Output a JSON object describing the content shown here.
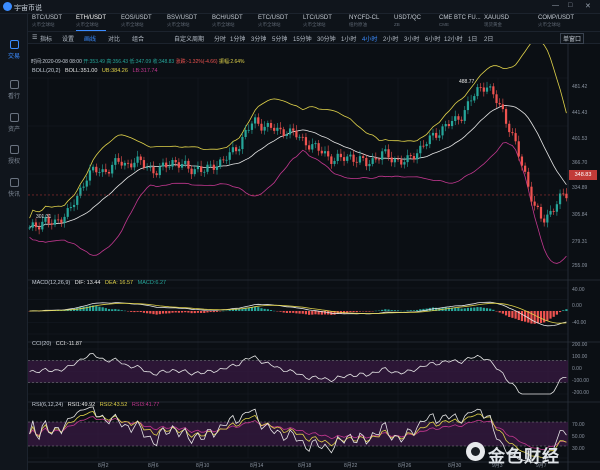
{
  "app": {
    "title": "宇宙币说"
  },
  "window": {
    "minimize": "—",
    "maximize": "□",
    "close": "✕"
  },
  "sidebar": {
    "items": [
      {
        "label": "交易",
        "icon": "chart-icon",
        "active": true
      },
      {
        "label": "看行",
        "icon": "quote-icon",
        "active": false
      },
      {
        "label": "资产",
        "icon": "wallet-icon",
        "active": false
      },
      {
        "label": "授权",
        "icon": "key-icon",
        "active": false
      },
      {
        "label": "快讯",
        "icon": "news-icon",
        "active": false
      }
    ]
  },
  "tickers": [
    {
      "symbol": "BTC/USDT",
      "sub": "火币全球站"
    },
    {
      "symbol": "ETH/USDT",
      "sub": "火币全球站",
      "active": true
    },
    {
      "symbol": "EOS/USDT",
      "sub": "火币全球站"
    },
    {
      "symbol": "BSV/USDT",
      "sub": "火币全球站"
    },
    {
      "symbol": "BCH/USDT",
      "sub": "火币全球站"
    },
    {
      "symbol": "ETC/USDT",
      "sub": "火币全球站"
    },
    {
      "symbol": "LTC/USDT",
      "sub": "火币全球站"
    },
    {
      "symbol": "NYCFD-CL",
      "sub": "纽约原油"
    },
    {
      "symbol": "USDT/QC",
      "sub": "ZB"
    },
    {
      "symbol": "CME BTC FU...",
      "sub": "CME"
    },
    {
      "symbol": "XAUUSD",
      "sub": "现货黄金"
    },
    {
      "symbol": "COMP/USDT",
      "sub": "火币全球站"
    }
  ],
  "toolbar": {
    "tools": [
      "指标",
      "设置",
      "画线",
      "对比",
      "组合"
    ],
    "active_tool": "画线",
    "custom_period": "自定义周期",
    "timeframes": [
      "分时",
      "1分钟",
      "3分钟",
      "5分钟",
      "15分钟",
      "30分钟",
      "1小时",
      "4小时",
      "2小时",
      "3小时",
      "6小时",
      "12小时",
      "1日",
      "2日"
    ],
    "active_timeframe": "4小时",
    "window_mode": "单窗口"
  },
  "info_line": {
    "time": "时间:2020-09-08 08:00",
    "open": "开:353.49",
    "high": "高:356.43",
    "low": "低:347.09",
    "close": "收:348.83",
    "change": "涨跌:-1.32%(-4.66)",
    "amplitude": "振幅:2.64%"
  },
  "boll": {
    "name": "BOLL(20,2)",
    "mid": "BOLL:351.00",
    "ub": "UB:384.26",
    "lb": "LB:317.74"
  },
  "macd": {
    "name": "MACD(12,26,9)",
    "dif": "DIF: 13.44",
    "dea": "DEA: 16.57",
    "macd": "MACD:6.27"
  },
  "cci": {
    "name": "CCI(20)",
    "value": "CCI:-11.87"
  },
  "rsi": {
    "name": "RSI(6,12,24)",
    "r1": "RSI1:49.92",
    "r2": "RSI2:43.52",
    "r3": "RSI3:41.77"
  },
  "price_axis": [
    "481.42",
    "441.43",
    "401.53",
    "366.70",
    "334.89",
    "305.84",
    "279.31",
    "255.09"
  ],
  "current_price": "348.83",
  "annotations": {
    "high": "488.77",
    "low": "301.31"
  },
  "macd_axis": [
    "40.00",
    "0.00",
    "-40.00"
  ],
  "cci_axis": [
    "200.00",
    "100.00",
    "0.00",
    "-100.00",
    "-200.00"
  ],
  "rsi_axis": [
    "70.00",
    "50.00",
    "30.00"
  ],
  "date_axis": [
    "8月2",
    "8月6",
    "8月10",
    "8月14",
    "8月18",
    "8月22",
    "8月26",
    "8月30",
    "9月3",
    "9月7"
  ],
  "watermark": "金色财经",
  "colors": {
    "up": "#26a69a",
    "down": "#ef5350",
    "boll_mid": "#e6e6e6",
    "boll_ub": "#e0d24a",
    "boll_lb": "#c2378f",
    "accent": "#3b8cff"
  },
  "chart_data": {
    "type": "candlestick",
    "close_path": [
      305,
      312,
      318,
      310,
      322,
      330,
      345,
      372,
      380,
      376,
      384,
      390,
      386,
      392,
      388,
      382,
      378,
      385,
      392,
      386,
      380,
      383,
      378,
      386,
      392,
      398,
      410,
      428,
      440,
      437,
      433,
      428,
      430,
      425,
      418,
      412,
      405,
      400,
      392,
      394,
      398,
      392,
      388,
      394,
      400,
      396,
      392,
      389,
      400,
      410,
      418,
      428,
      436,
      440,
      450,
      466,
      480,
      488,
      470,
      455,
      430,
      400,
      370,
      335,
      315,
      328,
      342,
      349
    ],
    "ylim": [
      255.09,
      495
    ]
  }
}
